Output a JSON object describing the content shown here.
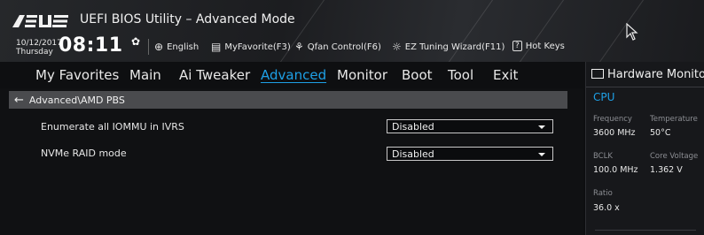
{
  "app": {
    "title": "UEFI BIOS Utility – Advanced Mode",
    "logo_text": "ASUS",
    "accent_color": "#1ea0e6"
  },
  "status": {
    "date": "10/12/2017",
    "day": "Thursday",
    "time": "08:11",
    "settings_icon": "gear-icon"
  },
  "toolbar": {
    "language": "English",
    "myfavorite": "MyFavorite(F3)",
    "qfan": "Qfan Control(F6)",
    "ez_tuning": "EZ Tuning Wizard(F11)",
    "hotkeys_key": "?",
    "hotkeys": "Hot Keys"
  },
  "nav": {
    "tabs": [
      {
        "label": "My Favorites"
      },
      {
        "label": "Main"
      },
      {
        "label": "Ai Tweaker"
      },
      {
        "label": "Advanced",
        "active": true
      },
      {
        "label": "Monitor"
      },
      {
        "label": "Boot"
      },
      {
        "label": "Tool"
      },
      {
        "label": "Exit"
      }
    ]
  },
  "main": {
    "breadcrumb": "Advanced\\AMD PBS",
    "settings": [
      {
        "label": "Enumerate all IOMMU in IVRS",
        "value": "Disabled"
      },
      {
        "label": "NVMe RAID mode",
        "value": "Disabled"
      }
    ]
  },
  "hardware_monitor": {
    "title": "Hardware Monitor",
    "section": "CPU",
    "frequency_label": "Frequency",
    "frequency_value": "3600 MHz",
    "temperature_label": "Temperature",
    "temperature_value": "50°C",
    "bclk_label": "BCLK",
    "bclk_value": "100.0 MHz",
    "core_voltage_label": "Core Voltage",
    "core_voltage_value": "1.362 V",
    "ratio_label": "Ratio",
    "ratio_value": "36.0 x"
  }
}
